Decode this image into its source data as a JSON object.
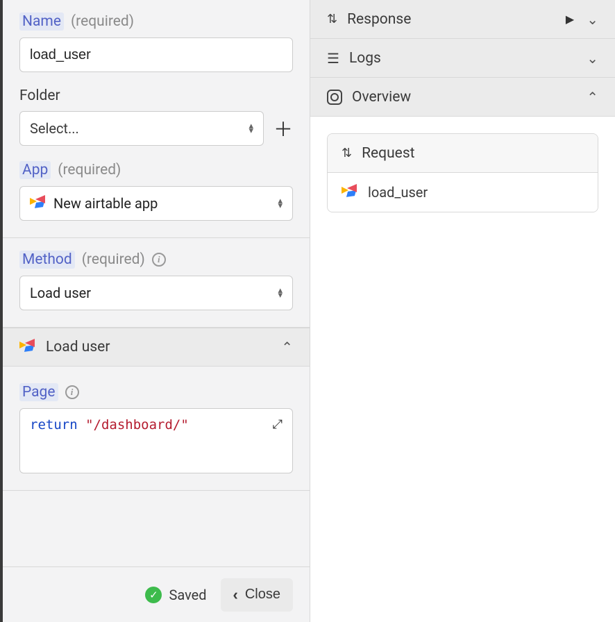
{
  "form": {
    "name": {
      "label": "Name",
      "required_text": "(required)",
      "value": "load_user"
    },
    "folder": {
      "label": "Folder",
      "placeholder": "Select..."
    },
    "app": {
      "label": "App",
      "required_text": "(required)",
      "value": "New airtable app"
    },
    "method": {
      "label": "Method",
      "required_text": "(required)",
      "value": "Load user"
    }
  },
  "method_section": {
    "title": "Load user"
  },
  "page_section": {
    "label": "Page",
    "code": {
      "keyword": "return",
      "string": "\"/dashboard/\""
    }
  },
  "footer": {
    "saved_text": "Saved",
    "close_text": "Close"
  },
  "right": {
    "response": "Response",
    "logs": "Logs",
    "overview": "Overview",
    "request_card": {
      "header": "Request",
      "item": "load_user"
    }
  }
}
